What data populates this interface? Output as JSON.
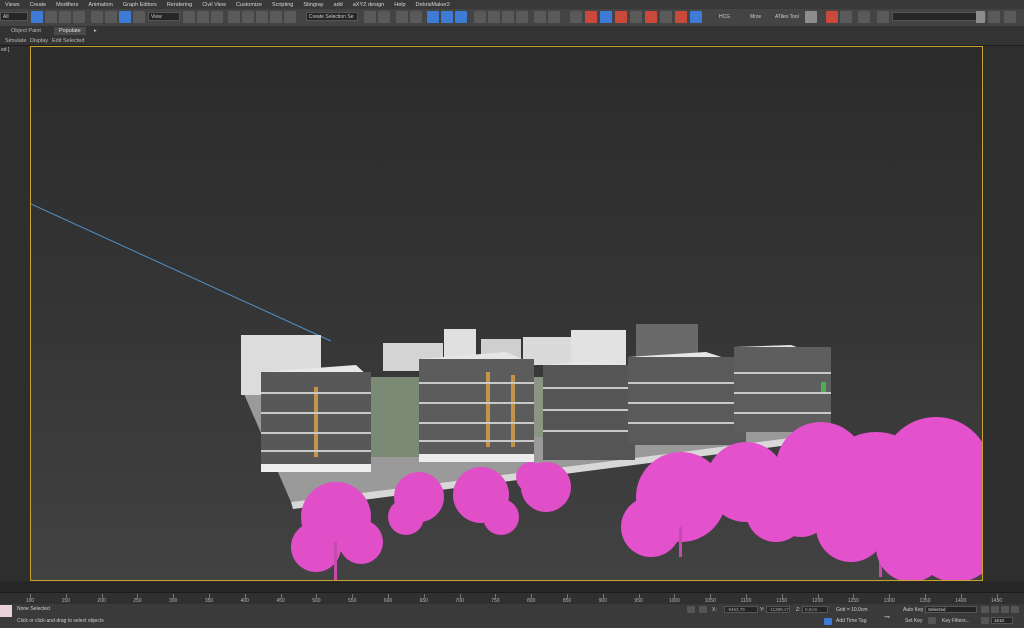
{
  "menu": {
    "items": [
      "Views",
      "Create",
      "Modifiers",
      "Animation",
      "Graph Editors",
      "Rendering",
      "Civil View",
      "Customize",
      "Scripting",
      "Stingray",
      "add",
      "aXYZ design",
      "Help",
      "DebrisMaker2"
    ]
  },
  "toolbar": {
    "left_dropdown": "All",
    "view_dropdown": "View",
    "selection_set_dropdown": "Create Selection Se",
    "buttons_right": [
      "HCG",
      "Mrze",
      "ATiles Tool"
    ]
  },
  "ribbon": {
    "tabs": [
      "Object Paint",
      "Populate"
    ],
    "active_tab": "Populate",
    "subtabs": [
      "Simulate",
      "Display",
      "Edit Selected"
    ]
  },
  "viewport": {
    "label": "ed ]"
  },
  "timeline": {
    "ticks": [
      "100",
      "150",
      "200",
      "250",
      "300",
      "350",
      "400",
      "450",
      "500",
      "550",
      "600",
      "650",
      "700",
      "750",
      "800",
      "850",
      "900",
      "950",
      "1000",
      "1050",
      "1100",
      "1150",
      "1200",
      "1250",
      "1300",
      "1350",
      "1400",
      "1450"
    ]
  },
  "status": {
    "selection": "None Selected",
    "prompt": "Click or click-and-drag to select objects",
    "x_label": "X:",
    "x_value": "-9463,79",
    "y_label": "Y:",
    "y_value": "-11389,17",
    "z_label": "Z:",
    "z_value": "0,0cm",
    "grid": "Grid = 10,0cm",
    "add_time_tag": "Add Time Tag",
    "auto_key": "Auto Key",
    "auto_key_value": "Selected",
    "set_key": "Set Key",
    "key_filters": "Key Filters...",
    "frame": "1510"
  },
  "colors": {
    "viewport_border": "#c9a227",
    "tree_color": "#e04fc8",
    "accent_blue": "#3d7bd6"
  }
}
